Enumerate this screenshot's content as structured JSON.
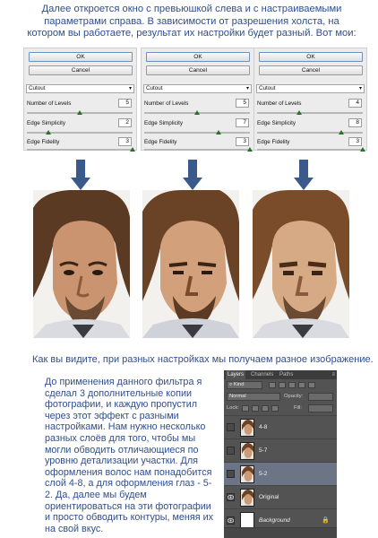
{
  "intro": {
    "text": "Далее откроется окно с превьюшкой слева и с настраиваемыми параметрами справа. В зависимости от разрешения холста, на котором вы работаете, результат их настройки будет разный. Вот мои:"
  },
  "dialogs": [
    {
      "ok": "OK",
      "cancel": "Cancel",
      "filter": "Cutout",
      "params": [
        {
          "label": "Number of Levels",
          "value": "5",
          "fraction": 0.5
        },
        {
          "label": "Edge Simplicity",
          "value": "2",
          "fraction": 0.2
        },
        {
          "label": "Edge Fidelity",
          "value": "3",
          "fraction": 1.0
        }
      ]
    },
    {
      "ok": "OK",
      "cancel": "Cancel",
      "filter": "Cutout",
      "params": [
        {
          "label": "Number of Levels",
          "value": "5",
          "fraction": 0.5
        },
        {
          "label": "Edge Simplicity",
          "value": "7",
          "fraction": 0.7
        },
        {
          "label": "Edge Fidelity",
          "value": "3",
          "fraction": 1.0
        }
      ]
    },
    {
      "ok": "OK",
      "cancel": "Cancel",
      "filter": "Cutout",
      "params": [
        {
          "label": "Number of Levels",
          "value": "4",
          "fraction": 0.4
        },
        {
          "label": "Edge Simplicity",
          "value": "8",
          "fraction": 0.8
        },
        {
          "label": "Edge Fidelity",
          "value": "3",
          "fraction": 1.0
        }
      ]
    }
  ],
  "caption": "Как вы видите, при разных настройках мы получаем разное изображение.",
  "body": "До применения данного фильтра я сделал 3 дополнительные копии фотографии, и каждую пропустил через этот эффект с разными настройками. Нам нужно несколько разных слоёв для того, чтобы мы могли обводить отличающиеся по уровню детализации участки. Для оформления волос нам понадобится слой 4-8, а для оформления глаз - 5-2. Да, далее мы будем ориентироваться на эти фотографии и просто обводить контуры, меняя их на свой вкус.",
  "layers_panel": {
    "tabs": [
      "Layers",
      "Channels",
      "Paths"
    ],
    "kind_label": "Kind",
    "blend_mode": "Normal",
    "opacity_label": "Opacity:",
    "lock_label": "Lock:",
    "fill_label": "Fill:",
    "layers": [
      {
        "name": "4-8",
        "selected": false
      },
      {
        "name": "5-7",
        "selected": false
      },
      {
        "name": "5-2",
        "selected": true
      },
      {
        "name": "Original",
        "selected": false
      },
      {
        "name": "Background",
        "selected": false
      }
    ]
  },
  "colors": {
    "text_blue": "#2f4e8f",
    "arrow_blue": "#3b5a8c",
    "panel_bg": "#535353",
    "layer_selected": "#6b7585"
  }
}
